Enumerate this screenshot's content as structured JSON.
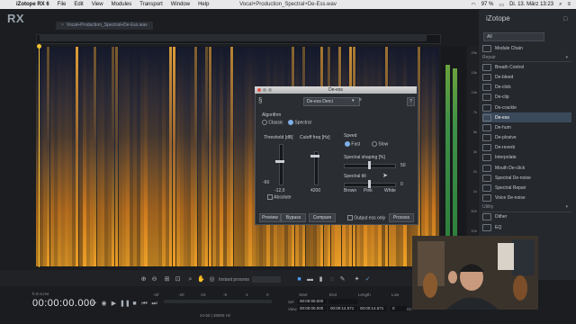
{
  "menubar": {
    "app": "iZotope RX 6",
    "items": [
      "File",
      "Edit",
      "View",
      "Modules",
      "Transport",
      "Window",
      "Help"
    ],
    "window_title": "Vocal+Production_Spectral+De-Ess.wav",
    "battery": "97 %",
    "datetime": "Di. 13. März 13:23"
  },
  "app": {
    "logo": "RX",
    "file_tab": "Vocal+Production_Spectral+De-Ess.wav"
  },
  "right_panel": {
    "brand": "iZotope",
    "dropdown": "All",
    "items": [
      {
        "label": "Module Chain",
        "kind": "item"
      },
      {
        "label": "Repair",
        "kind": "header"
      },
      {
        "label": "Breath Control",
        "kind": "item"
      },
      {
        "label": "De-bleed",
        "kind": "item"
      },
      {
        "label": "De-click",
        "kind": "item"
      },
      {
        "label": "De-clip",
        "kind": "item"
      },
      {
        "label": "De-crackle",
        "kind": "item"
      },
      {
        "label": "De-ess",
        "kind": "selected"
      },
      {
        "label": "De-hum",
        "kind": "item"
      },
      {
        "label": "De-plosive",
        "kind": "item"
      },
      {
        "label": "De-reverb",
        "kind": "item"
      },
      {
        "label": "Interpolate",
        "kind": "item"
      },
      {
        "label": "Mouth De-click",
        "kind": "item"
      },
      {
        "label": "Spectral De-noise",
        "kind": "item"
      },
      {
        "label": "Spectral Repair",
        "kind": "item"
      },
      {
        "label": "Voice De-noise",
        "kind": "item"
      },
      {
        "label": "Utility",
        "kind": "header"
      },
      {
        "label": "Dither",
        "kind": "item"
      },
      {
        "label": "EQ",
        "kind": "item"
      }
    ]
  },
  "dialog": {
    "title": "De-ess",
    "preset": "De-ess Derci",
    "help": "?",
    "algorithm_label": "Algorithm",
    "algorithms": [
      "Classic",
      "Spectral"
    ],
    "threshold_label": "Threshold [dB]",
    "threshold_value": "-12,0",
    "threshold_min": "-60",
    "cutoff_label": "Cutoff freq [Hz]",
    "cutoff_value": "4200",
    "absolute_label": "Absolute",
    "speed_label": "Speed",
    "speeds": [
      "Fast",
      "Slow"
    ],
    "shaping_label": "Spectral shaping [%]",
    "shaping_value": "50",
    "tilt_label": "Spectral tilt",
    "tilt_value": "0",
    "tilt_scale": [
      "Brown",
      "Pink",
      "White"
    ],
    "buttons": {
      "preview": "Preview",
      "bypass": "Bypass",
      "compare": "Compare",
      "output_ess": "Output ess only",
      "process": "Process"
    }
  },
  "transport": {
    "instant_process": "Instant process",
    "timecode": "00:00:00.000",
    "format_label": "h:m:s.ms",
    "info": "24-bit | 48000 Hz",
    "sel_label": "Sel",
    "view_label": "View",
    "start_label": "Start",
    "end_label": "End",
    "length_label": "Length",
    "low_label": "Low",
    "sel_start": "00:00:00.000",
    "sel_end": "",
    "view_start": "00:00:00.000",
    "view_end": "00:00:14.571",
    "view_length": "00:00:14.571",
    "low_value": "0",
    "hz_label": "Hz",
    "meter_marks": [
      "-Inf",
      "-20",
      "-10",
      "-5",
      "-1",
      "0"
    ]
  },
  "spectrogram": {
    "freq_labels": [
      "20k",
      "15k",
      "10k",
      "7k",
      "5k",
      "3k",
      "2k",
      "1k",
      "500",
      "200",
      "50"
    ],
    "colors": {
      "low": "#101320",
      "mid": "#3a2b19",
      "high": "#f0a020"
    }
  }
}
